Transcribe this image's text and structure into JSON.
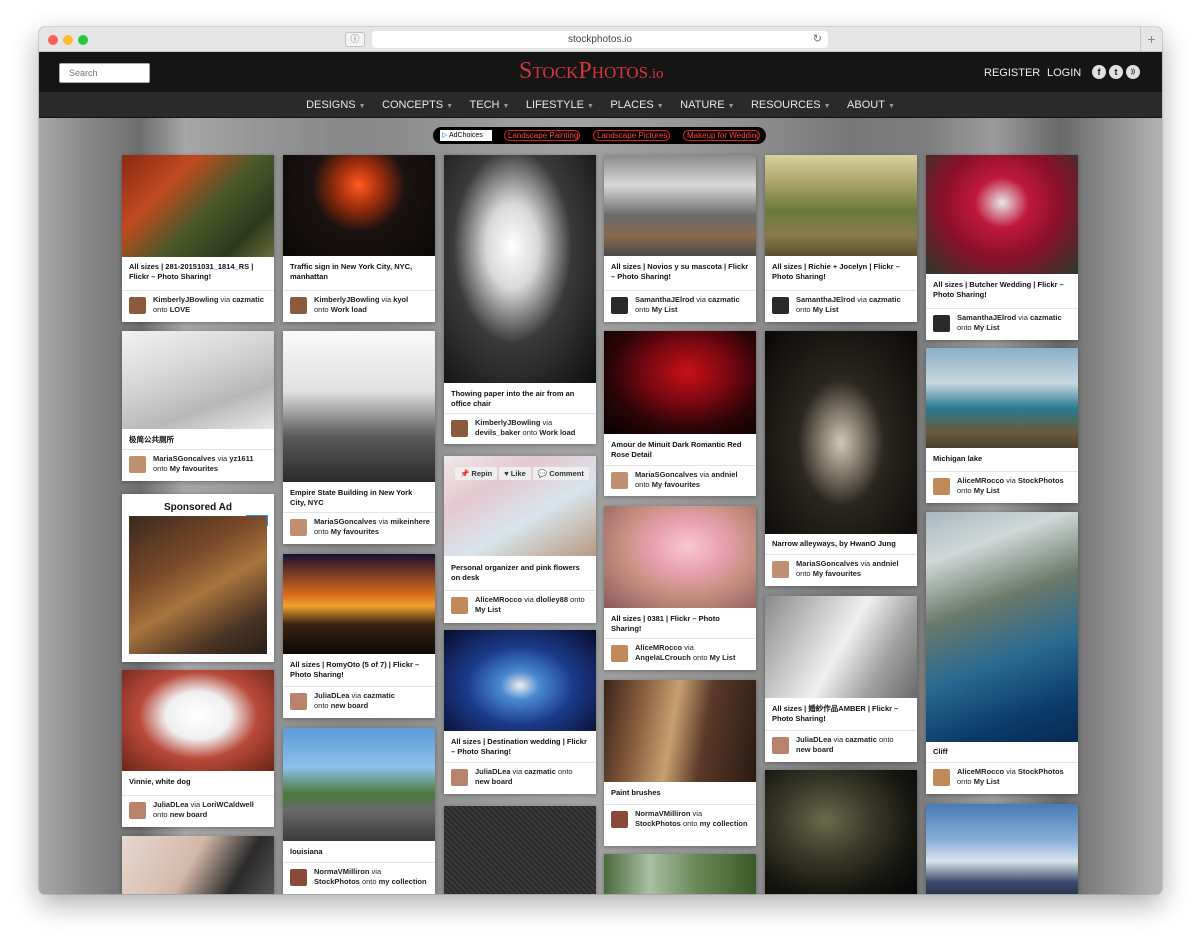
{
  "browser": {
    "url": "stockphotos.io",
    "reader": "ⓘ",
    "reload": "↻",
    "new_tab": "+"
  },
  "header": {
    "search_placeholder": "Search",
    "logo": {
      "s1": "S",
      "p1": "TOCK",
      "s2": "P",
      "p2": "HOTOS",
      "io": ".io"
    },
    "register": "REGISTER",
    "login": "LOGIN",
    "social": [
      "f",
      "t",
      "rss"
    ]
  },
  "nav": [
    "DESIGNS",
    "CONCEPTS",
    "TECH",
    "LIFESTYLE",
    "PLACES",
    "NATURE",
    "RESOURCES",
    "ABOUT"
  ],
  "ad_bar": {
    "adchoices": "AdChoices",
    "links": [
      "Landscape Painting",
      "Landscape Pictures",
      "Makeup for Wedding"
    ]
  },
  "pin_actions": {
    "repin": "📌 Repin",
    "like": "♥ Like",
    "comment": "💬 Comment"
  },
  "sponsored": {
    "title": "Sponsored Ad",
    "close": "i ✕"
  },
  "columns": [
    [
      {
        "title": "All sizes | 281-20151031_1814_RS | Flickr – Photo Sharing!",
        "user": "KimberlyJBowling",
        "via": "cazmatic",
        "board": "LOVE"
      },
      {
        "title": "极简公共厕所",
        "user": "MariaSGoncalves",
        "via": "yz1611",
        "board": "My favourites"
      },
      {
        "title": "Vinnie, white dog",
        "user": "JuliaDLea",
        "via": "LoriWCaldwell",
        "board": "new board"
      }
    ],
    [
      {
        "title": "Traffic sign in New York City, NYC, manhattan",
        "user": "KimberlyJBowling",
        "via": "kyol",
        "board": "Work load"
      },
      {
        "title": "Empire State Building in New York City, NYC",
        "user": "MariaSGoncalves",
        "via": "mikeinhere",
        "board": "My favourites"
      },
      {
        "title": "All sizes | RomyOto (5 of 7) | Flickr – Photo Sharing!",
        "user": "JuliaDLea",
        "via": "cazmatic",
        "board": "new board"
      },
      {
        "title": "louisiana",
        "user": "NormaVMilliron",
        "via": "StockPhotos",
        "board": "my collection"
      }
    ],
    [
      {
        "title": "Thowing paper into the air from an office chair",
        "user": "KimberlyJBowling",
        "via": "devils_baker",
        "board": "Work load"
      },
      {
        "title": "Personal organizer and pink flowers on desk",
        "user": "AliceMRocco",
        "via": "dlolley88",
        "board": "My List"
      },
      {
        "title": "All sizes | Destination wedding | Flickr – Photo Sharing!",
        "user": "JuliaDLea",
        "via": "cazmatic",
        "board": "new board"
      }
    ],
    [
      {
        "title": "All sizes | Novios y su mascota | Flickr – Photo Sharing!",
        "user": "SamanthaJElrod",
        "via": "cazmatic",
        "board": "My List"
      },
      {
        "title": "Amour de Minuit Dark Romantic Red Rose Detail",
        "user": "MariaSGoncalves",
        "via": "andniel",
        "board": "My favourites"
      },
      {
        "title": "All sizes | 0381 | Flickr – Photo Sharing!",
        "user": "AliceMRocco",
        "via": "AngelaLCrouch",
        "board": "My List"
      },
      {
        "title": "Paint brushes",
        "user": "NormaVMilliron",
        "via": "StockPhotos",
        "board": "my collection"
      }
    ],
    [
      {
        "title": "All sizes | Richie + Jocelyn | Flickr – Photo Sharing!",
        "user": "SamanthaJElrod",
        "via": "cazmatic",
        "board": "My List"
      },
      {
        "title": "Narrow alleyways, by HwanO Jung",
        "user": "MariaSGoncalves",
        "via": "andniel",
        "board": "My favourites"
      },
      {
        "title": "All sizes | 婚紗作品AMBER | Flickr – Photo Sharing!",
        "user": "JuliaDLea",
        "via": "cazmatic",
        "board": "new board"
      }
    ],
    [
      {
        "title": "All sizes | Butcher Wedding | Flickr – Photo Sharing!",
        "user": "SamanthaJElrod",
        "via": "cazmatic",
        "board": "My List"
      },
      {
        "title": "Michigan lake",
        "user": "AliceMRocco",
        "via": "StockPhotos",
        "board": "My List"
      },
      {
        "title": "Cliff",
        "user": "AliceMRocco",
        "via": "StockPhotos",
        "board": "My List"
      }
    ]
  ],
  "words": {
    "via": "via",
    "onto": "onto"
  },
  "colors": {
    "brand": "#d3373d",
    "header_bg": "#151515",
    "nav_bg": "#2a2a2a"
  }
}
